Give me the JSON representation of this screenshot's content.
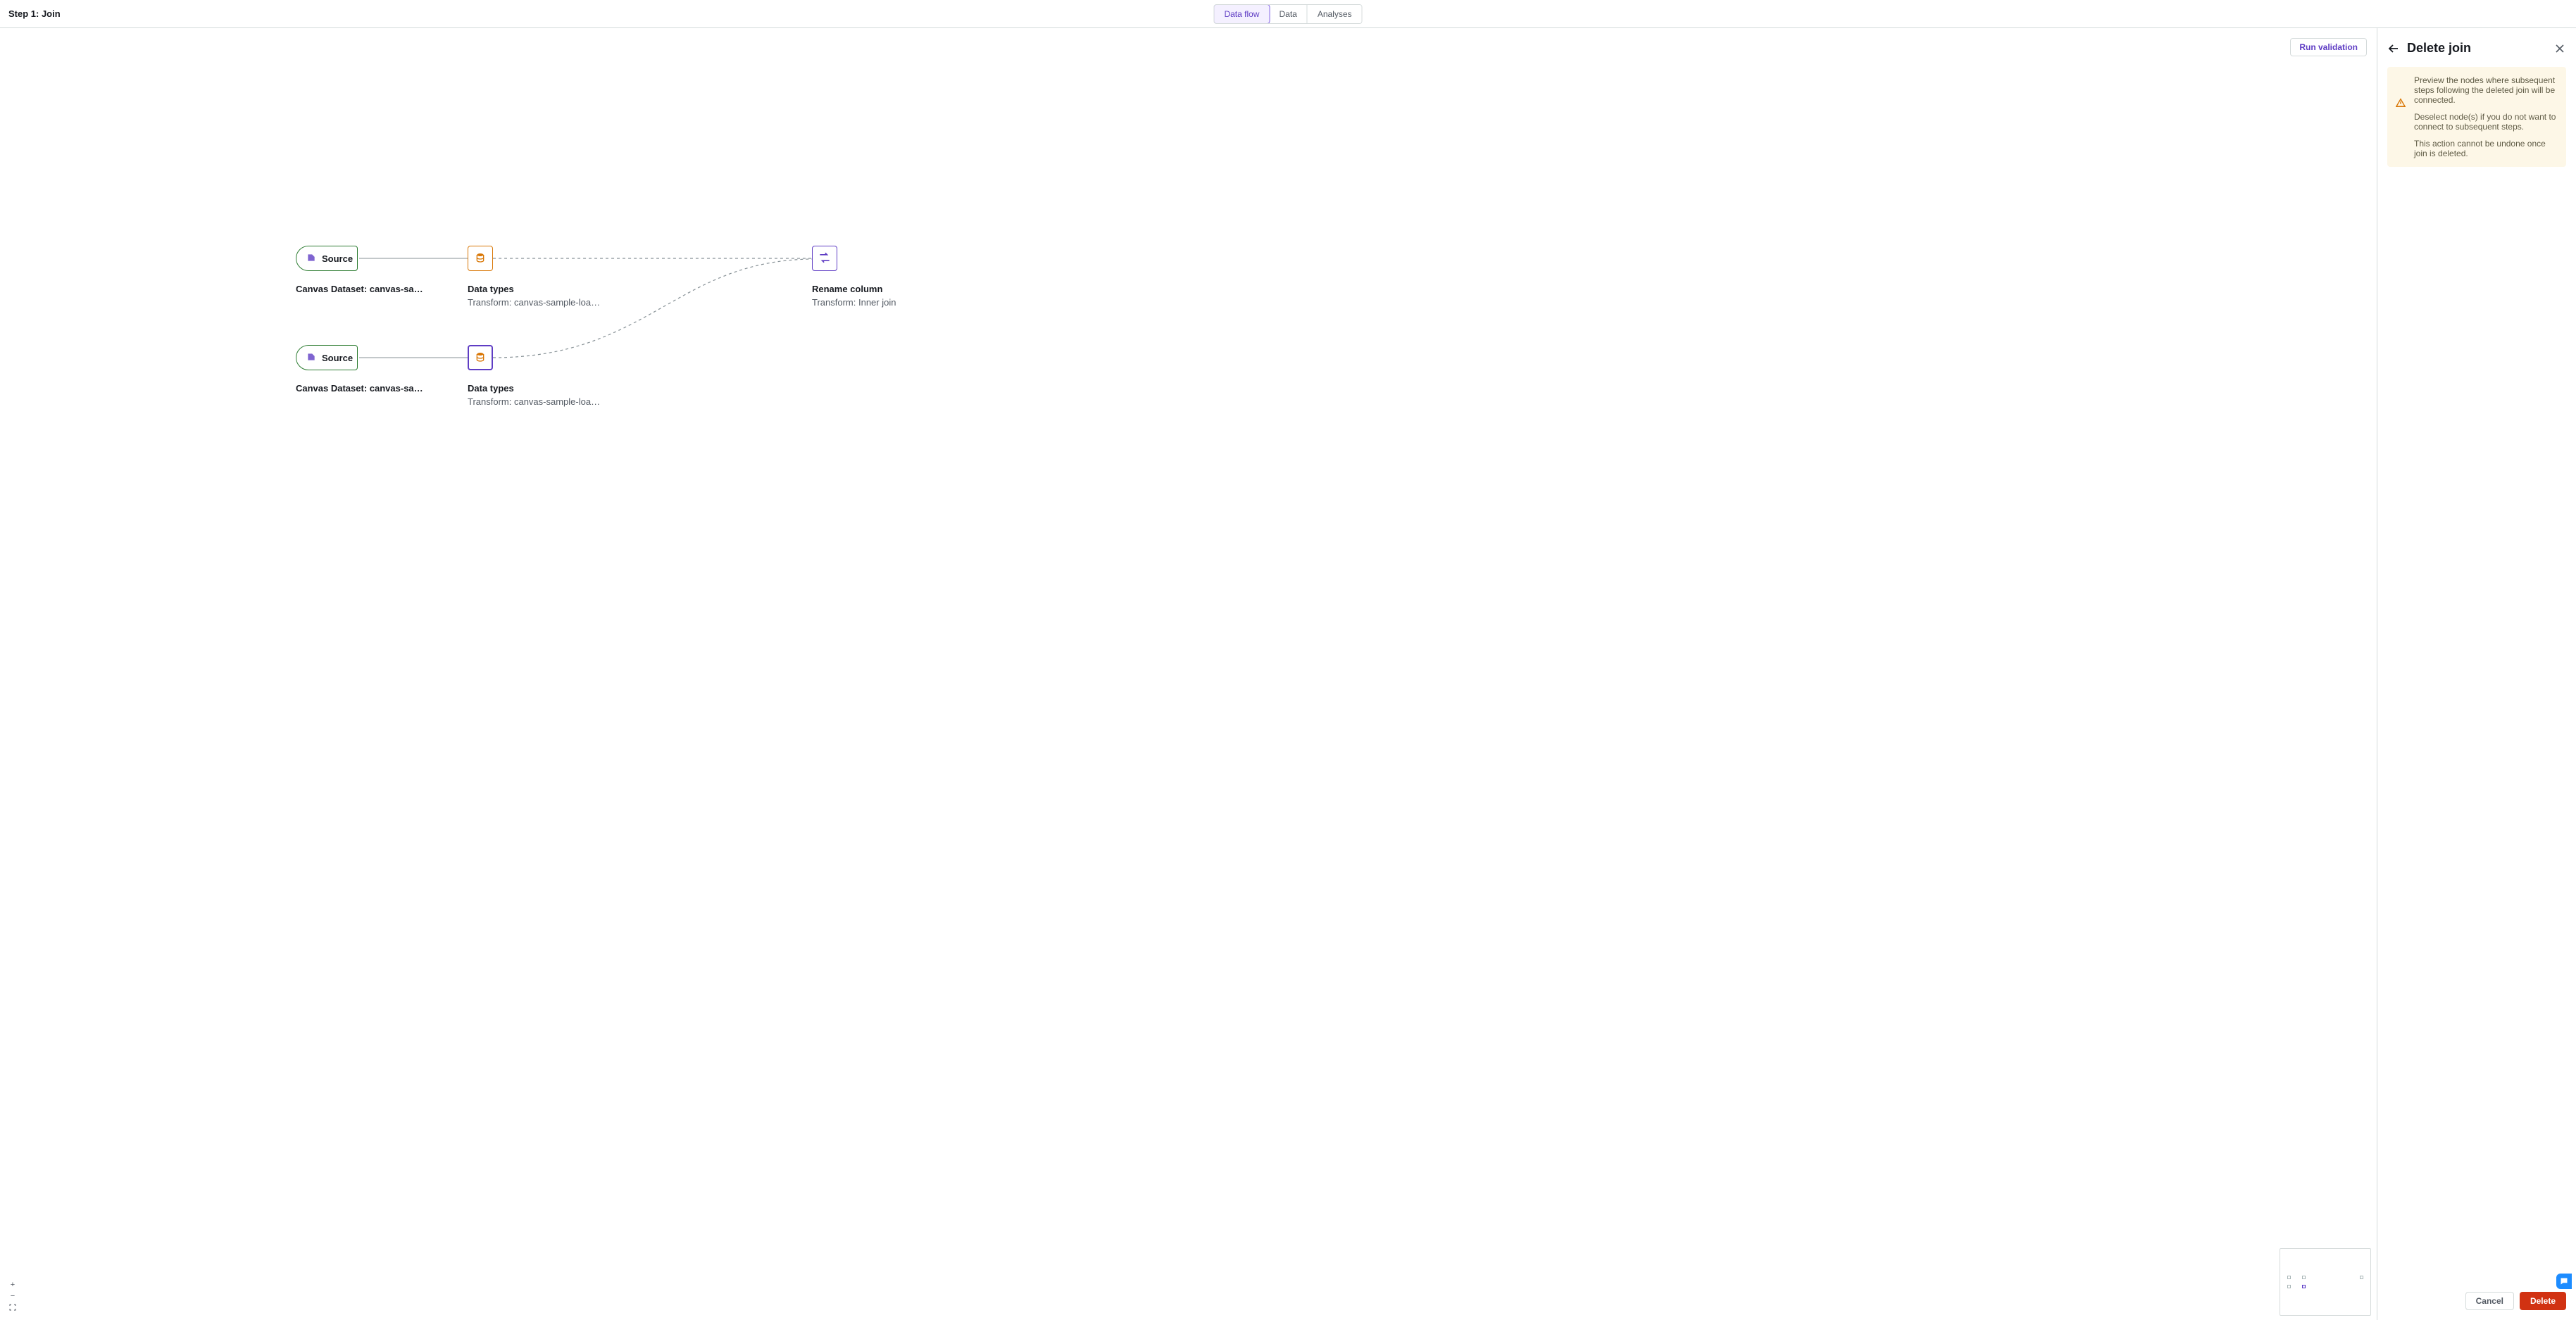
{
  "header": {
    "title": "Step 1: Join",
    "tabs": [
      "Data flow",
      "Data",
      "Analyses"
    ],
    "activeTab": 0,
    "runValidation": "Run validation"
  },
  "panel": {
    "title": "Delete join",
    "notice_preview": "Preview the nodes where subsequent steps following the deleted join will be connected.",
    "notice_deselect": "Deselect node(s) if you do not want to connect to subsequent steps.",
    "notice_warn": "This action cannot be undone once join is deleted.",
    "cancel": "Cancel",
    "delete": "Delete"
  },
  "nodes": {
    "source1": {
      "label": "Source",
      "title": "Canvas Dataset: canvas-sample-…"
    },
    "source2": {
      "label": "Source",
      "title": "Canvas Dataset: canvas-sample-…"
    },
    "dt1": {
      "title": "Data types",
      "sub": "Transform: canvas-sample-loans-part-…"
    },
    "dt2": {
      "title": "Data types",
      "sub": "Transform: canvas-sample-loans-part-…"
    },
    "rename": {
      "title": "Rename column",
      "sub": "Transform: Inner join"
    }
  },
  "icons": {
    "plus": "+",
    "minus": "−"
  }
}
